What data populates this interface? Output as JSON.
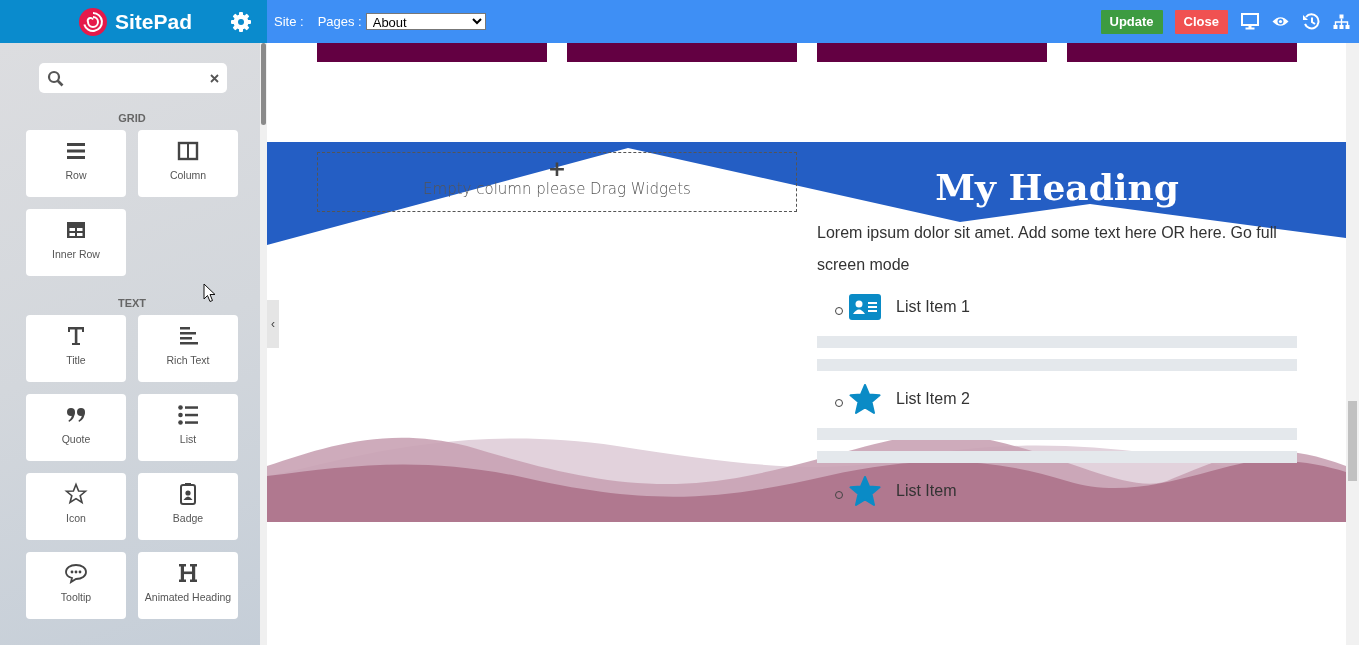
{
  "topbar": {
    "logo": "SitePad",
    "site_label": "Site :",
    "pages_label": "Pages :",
    "page_select": "About",
    "buttons": [
      {
        "label": "Update",
        "kind": "update"
      },
      {
        "label": "Close",
        "kind": "close"
      }
    ]
  },
  "sidebar": {
    "sections": [
      {
        "title": "GRID",
        "widgets": [
          {
            "label": "Row",
            "kind": "row"
          },
          {
            "label": "Column",
            "kind": "column"
          },
          {
            "label": "Inner Row",
            "kind": "inner-row"
          }
        ]
      },
      {
        "title": "TEXT",
        "widgets": [
          {
            "label": "Title",
            "kind": "title"
          },
          {
            "label": "Rich Text",
            "kind": "rich-text"
          },
          {
            "label": "Quote",
            "kind": "quote"
          },
          {
            "label": "List",
            "kind": "list"
          },
          {
            "label": "Icon",
            "kind": "icon"
          },
          {
            "label": "Badge",
            "kind": "badge"
          },
          {
            "label": "Tooltip",
            "kind": "tooltip"
          },
          {
            "label": "Animated Heading",
            "kind": "animated-heading"
          }
        ]
      }
    ]
  },
  "canvas": {
    "collapse_handle": "‹",
    "placeholder": {
      "icon": "+",
      "text": "Empty column please Drag Widgets"
    },
    "heading": "My Heading",
    "paragraph": "Lorem ipsum dolor sit amet. Add some text here OR here. Go full screen mode",
    "list": [
      {
        "kind": "id-card",
        "text": "List Item 1"
      },
      {
        "kind": "star",
        "text": "List Item 2"
      },
      {
        "kind": "star",
        "text": "List Item"
      }
    ]
  }
}
